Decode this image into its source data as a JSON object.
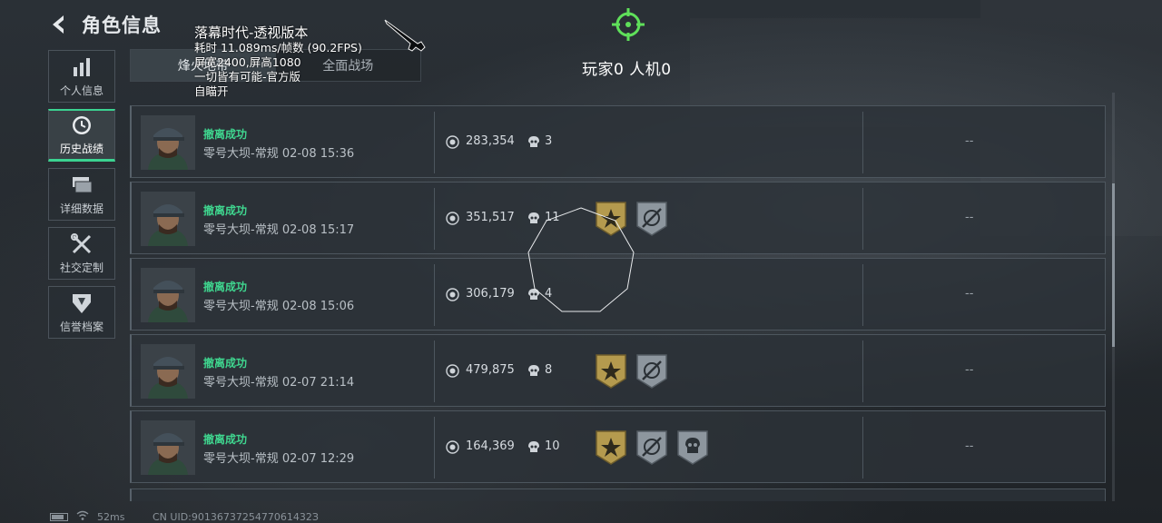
{
  "header": {
    "title": "角色信息"
  },
  "sidebar": {
    "items": [
      {
        "label": "个人信息",
        "icon": "bar-chart-icon",
        "active": false
      },
      {
        "label": "历史战绩",
        "icon": "clock-history-icon",
        "active": true
      },
      {
        "label": "详细数据",
        "icon": "stacked-cards-icon",
        "active": false
      },
      {
        "label": "社交定制",
        "icon": "wrench-screwdriver-icon",
        "active": false
      },
      {
        "label": "信誉档案",
        "icon": "emblem-icon",
        "active": false
      }
    ]
  },
  "tabs": [
    {
      "label": "烽火地带",
      "active": true
    },
    {
      "label": "全面战场",
      "active": false
    }
  ],
  "overlay": {
    "title": "落幕时代-透视版本",
    "lines": [
      "耗时 11.089ms/帧数 (90.2FPS)",
      "屏宽2400,屏高1080",
      "一切皆有可能-官方版",
      "自瞄开"
    ]
  },
  "player_counts": "玩家0 人机0",
  "records": [
    {
      "status": "撤离成功",
      "map": "零号大坝-常规 02-08 15:36",
      "value": "283,354",
      "kills": "3",
      "badges": [],
      "extra": "--"
    },
    {
      "status": "撤离成功",
      "map": "零号大坝-常规 02-08 15:17",
      "value": "351,517",
      "kills": "11",
      "badges": [
        "gold-star-badge-icon",
        "crossed-sniper-badge-icon"
      ],
      "extra": "--"
    },
    {
      "status": "撤离成功",
      "map": "零号大坝-常规 02-08 15:06",
      "value": "306,179",
      "kills": "4",
      "badges": [],
      "extra": "--"
    },
    {
      "status": "撤离成功",
      "map": "零号大坝-常规 02-07 21:14",
      "value": "479,875",
      "kills": "8",
      "badges": [
        "gold-star-badge-icon",
        "crossed-sniper-badge-icon"
      ],
      "extra": "--"
    },
    {
      "status": "撤离成功",
      "map": "零号大坝-常规 02-07 12:29",
      "value": "164,369",
      "kills": "10",
      "badges": [
        "gold-star-badge-icon",
        "crossed-sniper-badge-icon",
        "skull-badge-icon"
      ],
      "extra": "--"
    }
  ],
  "footer": {
    "ping": "52ms",
    "uid": "CN UID:9013673725477061432З"
  },
  "colors": {
    "accent_green": "#3bd391",
    "status_green": "#3fd68f",
    "gold_badge": "#b49a4e",
    "crosshair": "#5fe05a"
  }
}
